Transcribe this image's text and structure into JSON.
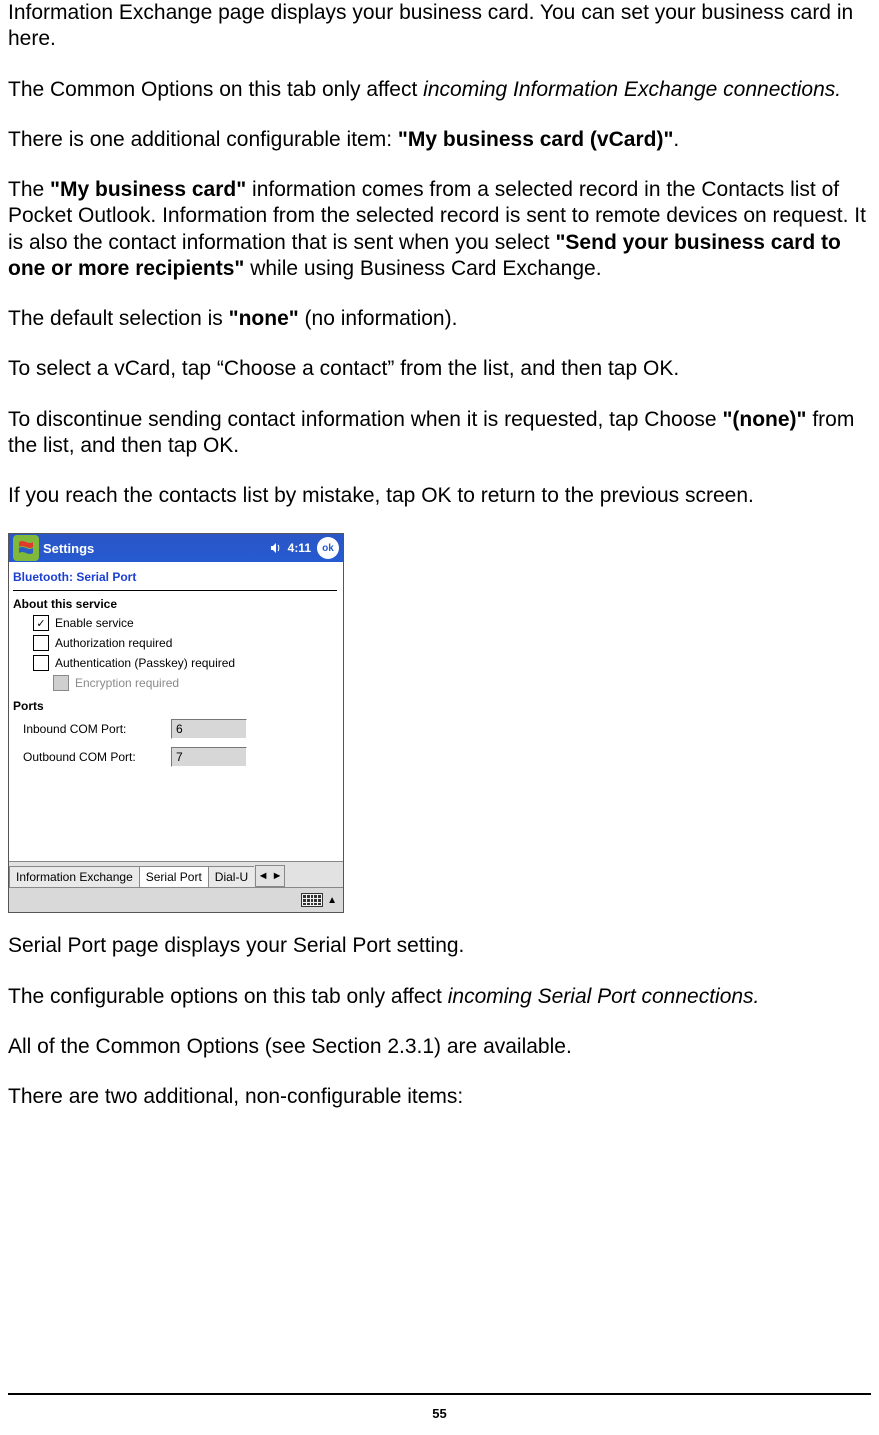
{
  "paragraphs": {
    "p1": "Information Exchange page displays your business card. You can set your business card in here.",
    "p2_pre": "The Common Options on this tab only affect ",
    "p2_em": "incoming Information Exchange connections.",
    "p3_pre": "There is one additional configurable item: ",
    "p3_bold": "\"My business card (vCard)\"",
    "p3_post": ".",
    "p4_a": "The ",
    "p4_b": "\"My business card\"",
    "p4_c": " information comes from a selected record in the Contacts list of Pocket Outlook. Information from the selected record is sent to remote devices on request. It is also the contact information that is sent when you select ",
    "p4_d": "\"Send your business card to one or more recipients\"",
    "p4_e": " while using Business Card Exchange.",
    "p5_a": "The default selection is ",
    "p5_b": "\"none\"",
    "p5_c": " (no information).",
    "p6": "To select a vCard, tap “Choose a contact” from the list, and then tap OK.",
    "p7_a": "To discontinue sending contact information when it is requested, tap Choose ",
    "p7_b": "\"(none)\"",
    "p7_c": " from the list, and then tap OK.",
    "p8": "If you reach the contacts list by mistake, tap OK to return to the previous screen.",
    "p9": "Serial Port page displays your Serial Port setting.",
    "p10_a": "The configurable options on this tab only affect ",
    "p10_b": "incoming Serial Port connections.",
    "p11": "All of the Common Options (see Section 2.3.1) are available.",
    "p12": "There are two additional, non-configurable items:"
  },
  "device": {
    "titlebar": {
      "title": "Settings",
      "time": "4:11",
      "ok": "ok"
    },
    "subtitle": "Bluetooth: Serial Port",
    "section_about": "About this service",
    "checks": {
      "enable": {
        "label": "Enable service",
        "checked": true,
        "enabled": true
      },
      "auth": {
        "label": "Authorization required",
        "checked": false,
        "enabled": true
      },
      "passkey": {
        "label": "Authentication (Passkey) required",
        "checked": false,
        "enabled": true
      },
      "encrypt": {
        "label": "Encryption required",
        "checked": false,
        "enabled": false
      }
    },
    "section_ports": "Ports",
    "ports": {
      "inbound": {
        "label": "Inbound COM Port:",
        "value": "6"
      },
      "outbound": {
        "label": "Outbound COM Port:",
        "value": "7"
      }
    },
    "tabs": {
      "t1": "Information Exchange",
      "t2": "Serial Port",
      "t3": "Dial-U"
    },
    "arrows": {
      "left": "◄",
      "right": "►",
      "up": "▲"
    }
  },
  "page_number": "55"
}
